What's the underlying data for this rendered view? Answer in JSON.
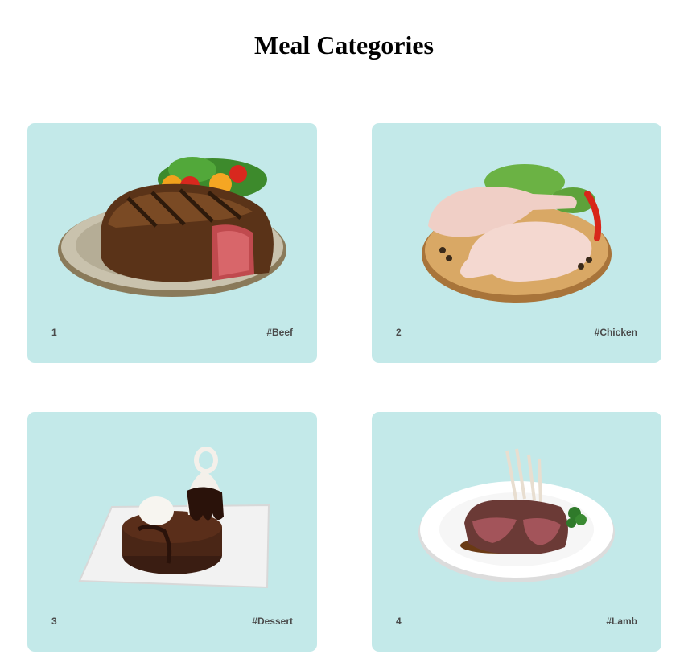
{
  "page": {
    "title": "Meal Categories"
  },
  "colors": {
    "card_background": "#c3e9e9",
    "label_text": "#4a4a4a"
  },
  "cards": [
    {
      "number": "1",
      "tag": "#Beef",
      "image": "grilled-steak-plate-image"
    },
    {
      "number": "2",
      "tag": "#Chicken",
      "image": "raw-chicken-board-image"
    },
    {
      "number": "3",
      "tag": "#Dessert",
      "image": "brownie-sundae-image"
    },
    {
      "number": "4",
      "tag": "#Lamb",
      "image": "lamb-rack-plate-image"
    }
  ]
}
